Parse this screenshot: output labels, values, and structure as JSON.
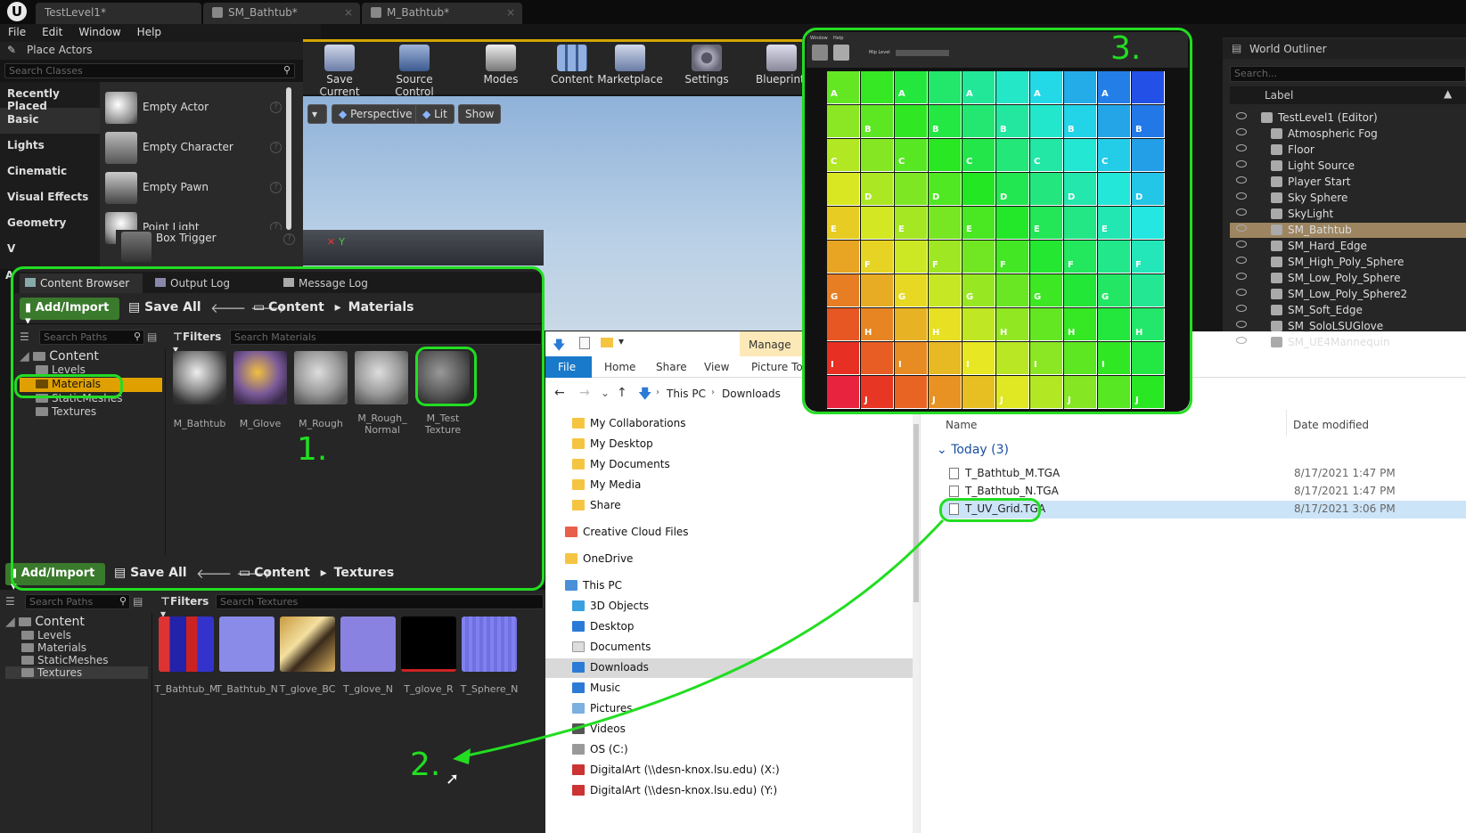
{
  "app": {
    "logo": "U"
  },
  "tabs": [
    {
      "label": "TestLevel1*"
    },
    {
      "label": "SM_Bathtub*"
    },
    {
      "label": "M_Bathtub*"
    }
  ],
  "menu": [
    "File",
    "Edit",
    "Window",
    "Help"
  ],
  "place_actors": {
    "title": "Place Actors",
    "search_placeholder": "Search Classes",
    "categories": [
      "Recently Placed",
      "Basic",
      "Lights",
      "Cinematic",
      "Visual Effects",
      "Geometry",
      "V",
      "A"
    ],
    "actors": [
      "Empty Actor",
      "Empty Character",
      "Empty Pawn",
      "Point Light",
      "Box Trigger"
    ]
  },
  "toolbar": {
    "buttons": [
      "Save Current",
      "Source Control",
      "Modes",
      "Content",
      "Marketplace",
      "Settings",
      "Blueprints"
    ]
  },
  "viewport": {
    "perspective": "Perspective",
    "lit": "Lit",
    "show": "Show",
    "axis_y": "Y"
  },
  "content_browser_1": {
    "tabs": [
      "Content Browser",
      "Output Log",
      "Message Log"
    ],
    "add_import": "Add/Import",
    "save_all": "Save All",
    "crumbs": [
      "Content",
      "Materials"
    ],
    "search_paths": "Search Paths",
    "filters": "Filters",
    "search_placeholder": "Search Materials",
    "tree": {
      "root": "Content",
      "items": [
        "Levels",
        "Materials",
        "StaticMeshes",
        "Textures"
      ]
    },
    "assets": [
      "M_Bathtub",
      "M_Glove",
      "M_Rough",
      "M_Rough_ Normal",
      "M_Test Texture"
    ]
  },
  "content_browser_2": {
    "add_import": "Add/Import",
    "save_all": "Save All",
    "crumbs": [
      "Content",
      "Textures"
    ],
    "search_paths": "Search Paths",
    "filters": "Filters",
    "search_placeholder": "Search Textures",
    "tree": {
      "root": "Content",
      "items": [
        "Levels",
        "Materials",
        "StaticMeshes",
        "Textures"
      ]
    },
    "assets": [
      "T_Bathtub_M",
      "T_Bathtub_N",
      "T_glove_BC",
      "T_glove_N",
      "T_glove_R",
      "T_Sphere_N"
    ]
  },
  "annotations": {
    "one": "1.",
    "two": "2.",
    "three": "3."
  },
  "explorer": {
    "ribbon": {
      "manage": "Manage",
      "tabs": [
        "File",
        "Home",
        "Share",
        "View",
        "Picture Tools"
      ]
    },
    "path": [
      "This PC",
      "Downloads"
    ],
    "nav": [
      "My Collaborations",
      "My Desktop",
      "My Documents",
      "My Media",
      "Share",
      "Creative Cloud Files",
      "OneDrive",
      "This PC",
      "3D Objects",
      "Desktop",
      "Documents",
      "Downloads",
      "Music",
      "Pictures",
      "Videos",
      "OS (C:)",
      "DigitalArt (\\\\desn-knox.lsu.edu) (X:)",
      "DigitalArt (\\\\desn-knox.lsu.edu) (Y:)"
    ],
    "columns": {
      "name": "Name",
      "date": "Date modified"
    },
    "group": "Today (3)",
    "files": [
      {
        "name": "T_Bathtub_M.TGA",
        "date": "8/17/2021 1:47 PM"
      },
      {
        "name": "T_Bathtub_N.TGA",
        "date": "8/17/2021 1:47 PM"
      },
      {
        "name": "T_UV_Grid.TGA",
        "date": "8/17/2021 3:06 PM"
      }
    ]
  },
  "world_outliner": {
    "title": "World Outliner",
    "search_placeholder": "Search...",
    "label_col": "Label",
    "items": [
      "TestLevel1 (Editor)",
      "Atmospheric Fog",
      "Floor",
      "Light Source",
      "Player Start",
      "Sky Sphere",
      "SkyLight",
      "SM_Bathtub",
      "SM_Hard_Edge",
      "SM_High_Poly_Sphere",
      "SM_Low_Poly_Sphere",
      "SM_Low_Poly_Sphere2",
      "SM_Soft_Edge",
      "SM_SoloLSUGlove",
      "SM_UE4Mannequin"
    ]
  },
  "uv_grid": {
    "rows": [
      "A",
      "B",
      "C",
      "D",
      "E",
      "F",
      "G",
      "H",
      "I",
      "J"
    ],
    "mini_menu": [
      "Window",
      "Help"
    ],
    "mip_label": "Mip Level"
  }
}
